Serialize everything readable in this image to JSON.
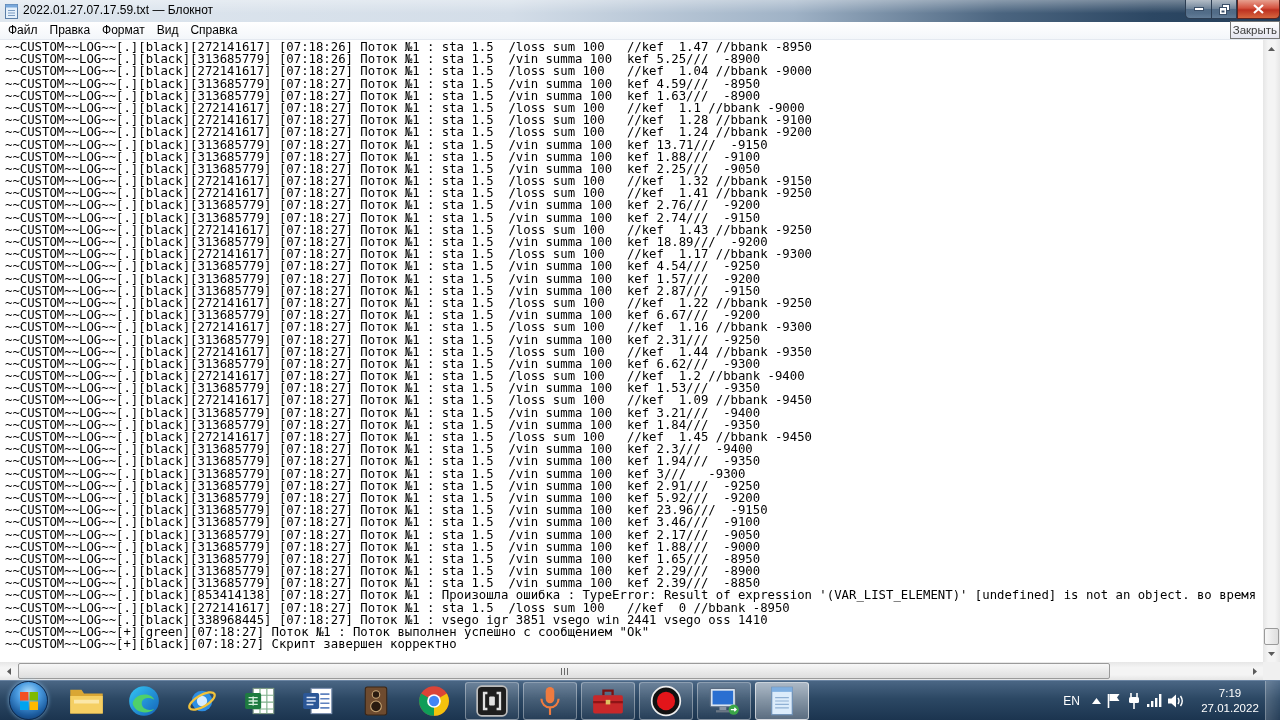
{
  "window": {
    "title": "2022.01.27.07.17.59.txt — Блокнот",
    "tooltip": "Закрыть"
  },
  "menu": [
    "Файл",
    "Правка",
    "Формат",
    "Вид",
    "Справка"
  ],
  "document": {
    "lines": [
      "~~CUSTOM~~LOG~~[.][black][272141617] [07:18:26] Поток №1 : sta 1.5  /loss sum 100   //kef  1.47 //bbank -8950",
      "~~CUSTOM~~LOG~~[.][black][313685779] [07:18:26] Поток №1 : sta 1.5  /vin summa 100  kef 5.25///  -8900",
      "~~CUSTOM~~LOG~~[.][black][272141617] [07:18:27] Поток №1 : sta 1.5  /loss sum 100   //kef  1.04 //bbank -9000",
      "~~CUSTOM~~LOG~~[.][black][313685779] [07:18:27] Поток №1 : sta 1.5  /vin summa 100  kef 4.59///  -8950",
      "~~CUSTOM~~LOG~~[.][black][313685779] [07:18:27] Поток №1 : sta 1.5  /vin summa 100  kef 1.63///  -8900",
      "~~CUSTOM~~LOG~~[.][black][272141617] [07:18:27] Поток №1 : sta 1.5  /loss sum 100   //kef  1.1 //bbank -9000",
      "~~CUSTOM~~LOG~~[.][black][272141617] [07:18:27] Поток №1 : sta 1.5  /loss sum 100   //kef  1.28 //bbank -9100",
      "~~CUSTOM~~LOG~~[.][black][272141617] [07:18:27] Поток №1 : sta 1.5  /loss sum 100   //kef  1.24 //bbank -9200",
      "~~CUSTOM~~LOG~~[.][black][313685779] [07:18:27] Поток №1 : sta 1.5  /vin summa 100  kef 13.71///  -9150",
      "~~CUSTOM~~LOG~~[.][black][313685779] [07:18:27] Поток №1 : sta 1.5  /vin summa 100  kef 1.88///  -9100",
      "~~CUSTOM~~LOG~~[.][black][313685779] [07:18:27] Поток №1 : sta 1.5  /vin summa 100  kef 2.25///  -9050",
      "~~CUSTOM~~LOG~~[.][black][272141617] [07:18:27] Поток №1 : sta 1.5  /loss sum 100   //kef  1.32 //bbank -9150",
      "~~CUSTOM~~LOG~~[.][black][272141617] [07:18:27] Поток №1 : sta 1.5  /loss sum 100   //kef  1.41 //bbank -9250",
      "~~CUSTOM~~LOG~~[.][black][313685779] [07:18:27] Поток №1 : sta 1.5  /vin summa 100  kef 2.76///  -9200",
      "~~CUSTOM~~LOG~~[.][black][313685779] [07:18:27] Поток №1 : sta 1.5  /vin summa 100  kef 2.74///  -9150",
      "~~CUSTOM~~LOG~~[.][black][272141617] [07:18:27] Поток №1 : sta 1.5  /loss sum 100   //kef  1.43 //bbank -9250",
      "~~CUSTOM~~LOG~~[.][black][313685779] [07:18:27] Поток №1 : sta 1.5  /vin summa 100  kef 18.89///  -9200",
      "~~CUSTOM~~LOG~~[.][black][272141617] [07:18:27] Поток №1 : sta 1.5  /loss sum 100   //kef  1.17 //bbank -9300",
      "~~CUSTOM~~LOG~~[.][black][313685779] [07:18:27] Поток №1 : sta 1.5  /vin summa 100  kef 4.54///  -9250",
      "~~CUSTOM~~LOG~~[.][black][313685779] [07:18:27] Поток №1 : sta 1.5  /vin summa 100  kef 1.57///  -9200",
      "~~CUSTOM~~LOG~~[.][black][313685779] [07:18:27] Поток №1 : sta 1.5  /vin summa 100  kef 2.87///  -9150",
      "~~CUSTOM~~LOG~~[.][black][272141617] [07:18:27] Поток №1 : sta 1.5  /loss sum 100   //kef  1.22 //bbank -9250",
      "~~CUSTOM~~LOG~~[.][black][313685779] [07:18:27] Поток №1 : sta 1.5  /vin summa 100  kef 6.67///  -9200",
      "~~CUSTOM~~LOG~~[.][black][272141617] [07:18:27] Поток №1 : sta 1.5  /loss sum 100   //kef  1.16 //bbank -9300",
      "~~CUSTOM~~LOG~~[.][black][313685779] [07:18:27] Поток №1 : sta 1.5  /vin summa 100  kef 2.31///  -9250",
      "~~CUSTOM~~LOG~~[.][black][272141617] [07:18:27] Поток №1 : sta 1.5  /loss sum 100   //kef  1.44 //bbank -9350",
      "~~CUSTOM~~LOG~~[.][black][313685779] [07:18:27] Поток №1 : sta 1.5  /vin summa 100  kef 6.62///  -9300",
      "~~CUSTOM~~LOG~~[.][black][272141617] [07:18:27] Поток №1 : sta 1.5  /loss sum 100   //kef  1.2 //bbank -9400",
      "~~CUSTOM~~LOG~~[.][black][313685779] [07:18:27] Поток №1 : sta 1.5  /vin summa 100  kef 1.53///  -9350",
      "~~CUSTOM~~LOG~~[.][black][272141617] [07:18:27] Поток №1 : sta 1.5  /loss sum 100   //kef  1.09 //bbank -9450",
      "~~CUSTOM~~LOG~~[.][black][313685779] [07:18:27] Поток №1 : sta 1.5  /vin summa 100  kef 3.21///  -9400",
      "~~CUSTOM~~LOG~~[.][black][313685779] [07:18:27] Поток №1 : sta 1.5  /vin summa 100  kef 1.84///  -9350",
      "~~CUSTOM~~LOG~~[.][black][272141617] [07:18:27] Поток №1 : sta 1.5  /loss sum 100   //kef  1.45 //bbank -9450",
      "~~CUSTOM~~LOG~~[.][black][313685779] [07:18:27] Поток №1 : sta 1.5  /vin summa 100  kef 2.3///  -9400",
      "~~CUSTOM~~LOG~~[.][black][313685779] [07:18:27] Поток №1 : sta 1.5  /vin summa 100  kef 1.94///  -9350",
      "~~CUSTOM~~LOG~~[.][black][313685779] [07:18:27] Поток №1 : sta 1.5  /vin summa 100  kef 3///   -9300",
      "~~CUSTOM~~LOG~~[.][black][313685779] [07:18:27] Поток №1 : sta 1.5  /vin summa 100  kef 2.91///  -9250",
      "~~CUSTOM~~LOG~~[.][black][313685779] [07:18:27] Поток №1 : sta 1.5  /vin summa 100  kef 5.92///  -9200",
      "~~CUSTOM~~LOG~~[.][black][313685779] [07:18:27] Поток №1 : sta 1.5  /vin summa 100  kef 23.96///  -9150",
      "~~CUSTOM~~LOG~~[.][black][313685779] [07:18:27] Поток №1 : sta 1.5  /vin summa 100  kef 3.46///  -9100",
      "~~CUSTOM~~LOG~~[.][black][313685779] [07:18:27] Поток №1 : sta 1.5  /vin summa 100  kef 2.17///  -9050",
      "~~CUSTOM~~LOG~~[.][black][313685779] [07:18:27] Поток №1 : sta 1.5  /vin summa 100  kef 1.88///  -9000",
      "~~CUSTOM~~LOG~~[.][black][313685779] [07:18:27] Поток №1 : sta 1.5  /vin summa 100  kef 1.65///  -8950",
      "~~CUSTOM~~LOG~~[.][black][313685779] [07:18:27] Поток №1 : sta 1.5  /vin summa 100  kef 2.29///  -8900",
      "~~CUSTOM~~LOG~~[.][black][313685779] [07:18:27] Поток №1 : sta 1.5  /vin summa 100  kef 2.39///  -8850",
      "~~CUSTOM~~LOG~~[.][black][853414138] [07:18:27] Поток №1 : Произошла ошибка : TypeError: Result of expression '(VAR_LIST_ELEMENT)' [undefined] is not an object. во время",
      "~~CUSTOM~~LOG~~[.][black][272141617] [07:18:27] Поток №1 : sta 1.5  /loss sum 100   //kef  0 //bbank -8950",
      "~~CUSTOM~~LOG~~[.][black][338968445] [07:18:27] Поток №1 : vsego igr 3851 vsego win 2441 vsego oss 1410",
      "~~CUSTOM~~LOG~~[+][green][07:18:27] Поток №1 : Поток выполнен успешно с сообщением \"Ok\"",
      "~~CUSTOM~~LOG~~[+][black][07:18:27] Скрипт завершен корректно"
    ]
  },
  "taskbar": {
    "apps": [
      {
        "kind": "folder",
        "running": false,
        "selected": false
      },
      {
        "kind": "swirl",
        "running": false,
        "selected": false
      },
      {
        "kind": "orbit",
        "running": false,
        "selected": false
      },
      {
        "kind": "spreadsheet",
        "running": false,
        "selected": false
      },
      {
        "kind": "document",
        "running": false,
        "selected": false
      },
      {
        "kind": "loudspeaker",
        "running": false,
        "selected": false
      },
      {
        "kind": "tricolor",
        "running": false,
        "selected": false
      },
      {
        "kind": "bracket",
        "running": true,
        "selected": false
      },
      {
        "kind": "microphone",
        "running": true,
        "selected": false
      },
      {
        "kind": "toolbox",
        "running": true,
        "selected": false
      },
      {
        "kind": "record",
        "running": true,
        "selected": false
      },
      {
        "kind": "monitor",
        "running": true,
        "selected": false
      },
      {
        "kind": "notepad",
        "running": true,
        "selected": true
      }
    ],
    "language": "EN",
    "time": "7:19",
    "date": "27.01.2022"
  }
}
